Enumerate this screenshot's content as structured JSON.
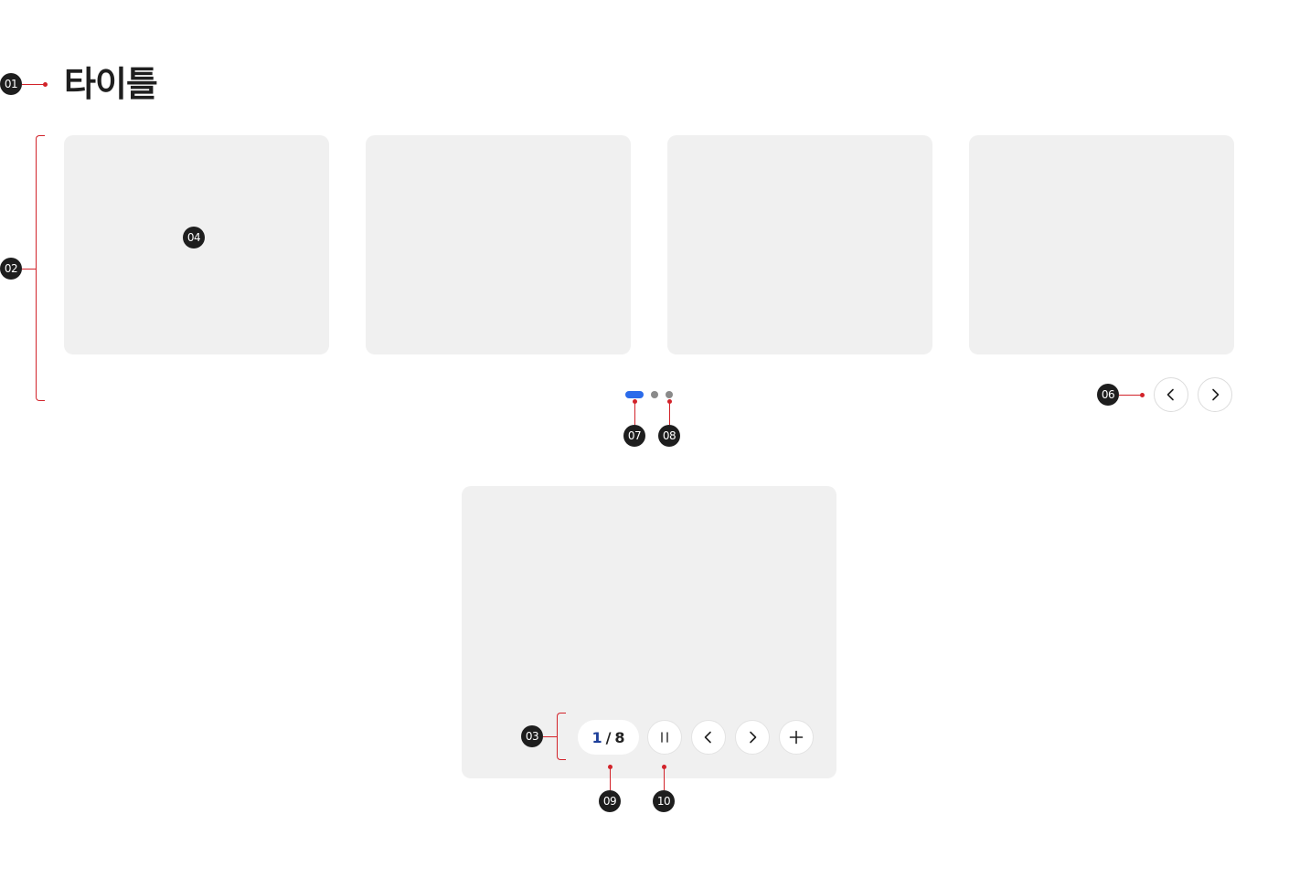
{
  "title": "타이틀",
  "annotations": {
    "a01": "01",
    "a02": "02",
    "a03": "03",
    "a04": "04",
    "a06": "06",
    "a07": "07",
    "a08": "08",
    "a09": "09",
    "a10": "10"
  },
  "carousel": {
    "card_count": 4,
    "indicators": [
      "active",
      "inactive",
      "inactive"
    ]
  },
  "single_slide": {
    "counter": {
      "current": "1",
      "separator": "/",
      "total": "8"
    }
  },
  "icons": {
    "prev": "chevron-left-icon",
    "next": "chevron-right-icon",
    "pause": "pause-icon",
    "plus": "plus-icon"
  },
  "colors": {
    "active_indicator": "#2b6bea",
    "inactive_indicator": "#8a8a8a",
    "annotation_line": "#d2232a",
    "badge": "#1e1e1e",
    "card": "#f0f0f0",
    "counter_current": "#1d3f9a"
  }
}
